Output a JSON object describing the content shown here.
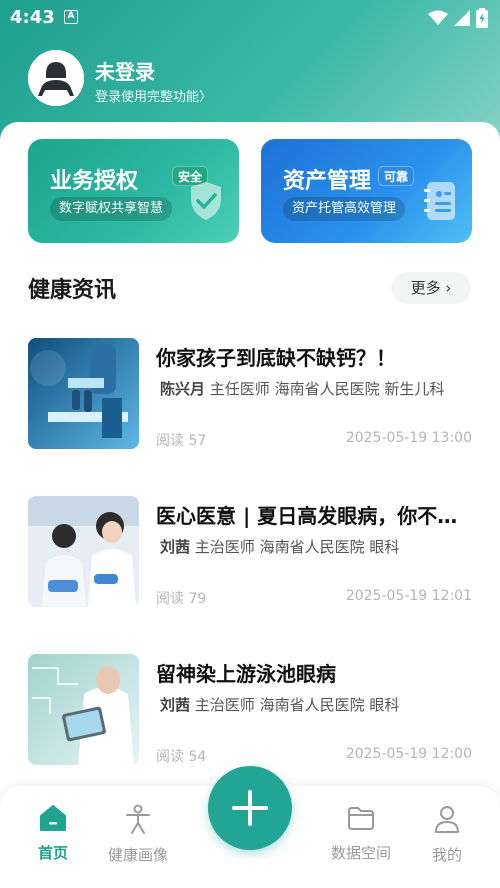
{
  "status_bar": {
    "time": "4:43",
    "a_glyph": "A"
  },
  "profile": {
    "title": "未登录",
    "subtitle": "登录使用完整功能〉"
  },
  "features": [
    {
      "title": "业务授权",
      "tag": "安全",
      "subtitle": "数字赋权共享智慧",
      "icon": "shield-check-icon"
    },
    {
      "title": "资产管理",
      "tag": "可靠",
      "subtitle": "资产托管高效管理",
      "icon": "notebook-icon"
    }
  ],
  "news": {
    "section_title": "健康资讯",
    "more_label": "更多",
    "articles": [
      {
        "title": "你家孩子到底缺不缺钙？！",
        "author": "陈兴月",
        "role": "主任医师 海南省人民医院 新生儿科",
        "read_label": "阅读 57",
        "date": "2025-05-19 13:00"
      },
      {
        "title": "医心医意 | 夏日高发眼病，你不可不知",
        "author": "刘茜",
        "role": "主治医师 海南省人民医院 眼科",
        "read_label": "阅读 79",
        "date": "2025-05-19 12:01"
      },
      {
        "title": "留神染上游泳池眼病",
        "author": "刘茜",
        "role": "主治医师 海南省人民医院 眼科",
        "read_label": "阅读 54",
        "date": "2025-05-19 12:00"
      }
    ]
  },
  "bottom_nav": {
    "items": [
      {
        "label": "首页",
        "icon": "home-icon",
        "active": true
      },
      {
        "label": "健康画像",
        "icon": "person-icon",
        "active": false
      },
      {
        "label": "数据空间",
        "icon": "folder-icon",
        "active": false
      },
      {
        "label": "我的",
        "icon": "user-icon",
        "active": false
      }
    ],
    "fab_icon": "plus-icon"
  },
  "colors": {
    "accent": "#1fa48e",
    "blue": "#1d72d6",
    "muted": "#b5b5b5"
  }
}
